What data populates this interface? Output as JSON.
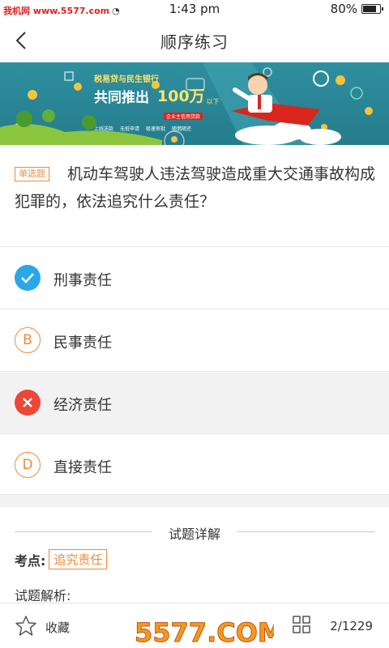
{
  "status": {
    "site": "我机网 www.5577.com",
    "time": "1:43 pm",
    "battery": "80%",
    "battery_level": 0.8
  },
  "header": {
    "title": "顺序练习"
  },
  "banner": {
    "line1": "税易贷与民生银行",
    "line2": "共同推出",
    "amount": "100万",
    "amount_suffix": "以下",
    "sub": "企业主信用贷款",
    "features": [
      "上线送款",
      "无抵申请",
      "极速审批",
      "随借随还"
    ]
  },
  "question": {
    "type_tag": "单选题",
    "text": "机动车驾驶人违法驾驶造成重大交通事故构成犯罪的，依法追究什么责任？"
  },
  "options": [
    {
      "letter": "A",
      "text": "刑事责任",
      "state": "correct"
    },
    {
      "letter": "B",
      "text": "民事责任",
      "state": "normal"
    },
    {
      "letter": "C",
      "text": "经济责任",
      "state": "wrong"
    },
    {
      "letter": "D",
      "text": "直接责任",
      "state": "normal"
    }
  ],
  "detail": {
    "title": "试题详解",
    "kaodian_label": "考点:",
    "kaodian_tag": "追究责任",
    "analysis_label": "试题解析:"
  },
  "bottom": {
    "favorite_label": "收藏",
    "page_counter": "2/1229"
  },
  "watermark": {
    "text": "5577.COM"
  }
}
